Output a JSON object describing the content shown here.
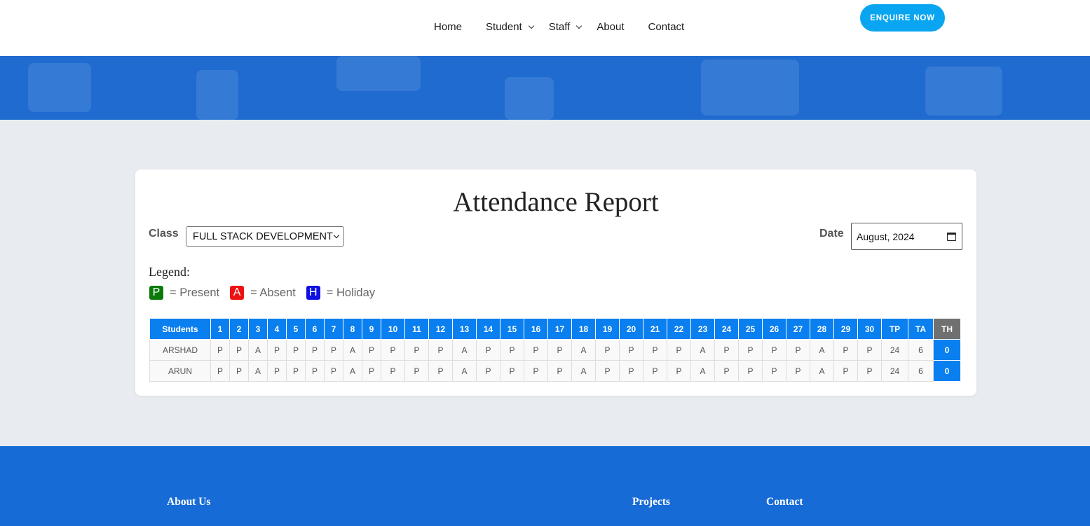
{
  "nav": {
    "items": [
      "Home",
      "Student",
      "Staff",
      "About",
      "Contact"
    ],
    "enquire": "ENQUIRE NOW"
  },
  "report": {
    "title": "Attendance Report",
    "class_label": "Class",
    "class_value": "FULL STACK DEVELOPMENT",
    "date_label": "Date",
    "date_value": "August, 2024",
    "legend_label": "Legend:",
    "legend": [
      {
        "letter": "P",
        "text": "= Present",
        "color": "#0b7a0b"
      },
      {
        "letter": "A",
        "text": "= Absent",
        "color": "#ee1111"
      },
      {
        "letter": "H",
        "text": "= Holiday",
        "color": "#1010e0"
      }
    ]
  },
  "table": {
    "headers": [
      "Students",
      "1",
      "2",
      "3",
      "4",
      "5",
      "6",
      "7",
      "8",
      "9",
      "10",
      "11",
      "12",
      "13",
      "14",
      "15",
      "16",
      "17",
      "18",
      "19",
      "20",
      "21",
      "22",
      "23",
      "24",
      "25",
      "26",
      "27",
      "28",
      "29",
      "30",
      "TP",
      "TA",
      "TH"
    ],
    "rows": [
      {
        "name": "ARSHAD",
        "days": [
          "P",
          "P",
          "A",
          "P",
          "P",
          "P",
          "P",
          "A",
          "P",
          "P",
          "P",
          "P",
          "A",
          "P",
          "P",
          "P",
          "P",
          "A",
          "P",
          "P",
          "P",
          "P",
          "A",
          "P",
          "P",
          "P",
          "P",
          "A",
          "P",
          "P"
        ],
        "tp": "24",
        "ta": "6",
        "th": "0"
      },
      {
        "name": "ARUN",
        "days": [
          "P",
          "P",
          "A",
          "P",
          "P",
          "P",
          "P",
          "A",
          "P",
          "P",
          "P",
          "P",
          "A",
          "P",
          "P",
          "P",
          "P",
          "A",
          "P",
          "P",
          "P",
          "P",
          "A",
          "P",
          "P",
          "P",
          "P",
          "A",
          "P",
          "P"
        ],
        "tp": "24",
        "ta": "6",
        "th": "0"
      }
    ]
  },
  "footer": {
    "about": "About Us",
    "projects": "Projects",
    "contact": "Contact"
  },
  "colors": {
    "accent": "#0a7ff0",
    "hero": "#1f6bd0",
    "footer": "#176bd6",
    "enquire": "#0aa5f0"
  }
}
